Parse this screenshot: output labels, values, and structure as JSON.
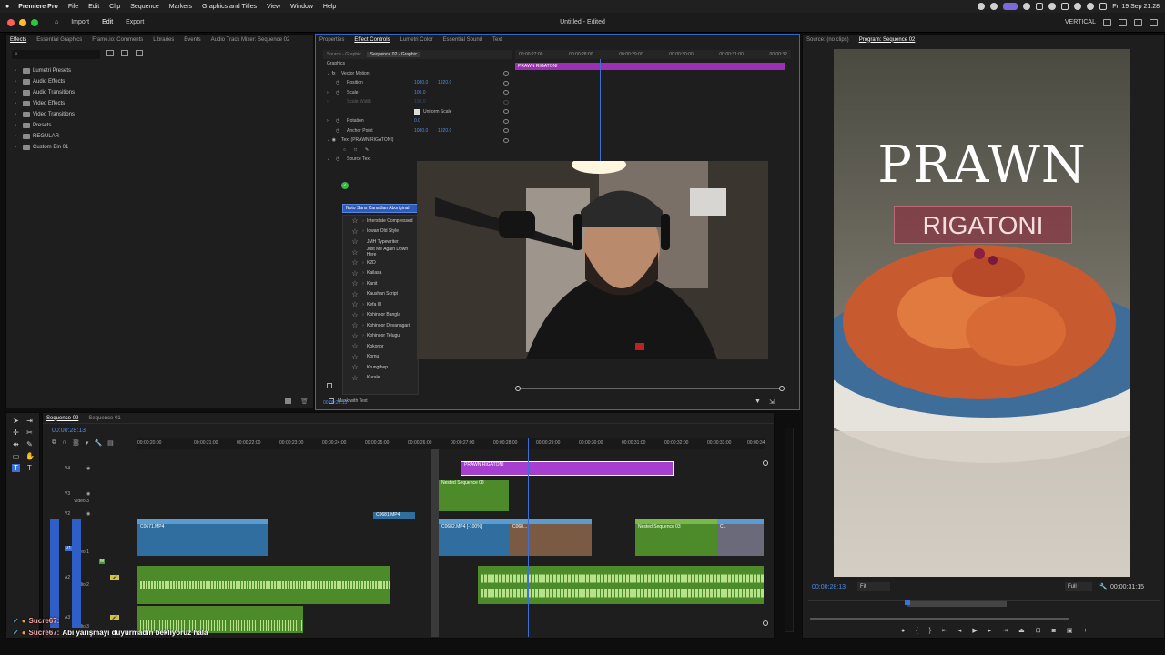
{
  "menubar": {
    "app": "Premiere Pro",
    "items": [
      "File",
      "Edit",
      "Clip",
      "Sequence",
      "Markers",
      "Graphics and Titles",
      "View",
      "Window",
      "Help"
    ],
    "datetime": "Fri 19 Sep  21:28"
  },
  "apptitle": {
    "nav": [
      "Import",
      "Edit",
      "Export"
    ],
    "active": "Edit",
    "title": "Untitled - Edited",
    "layout": "VERTICAL"
  },
  "effects_panel": {
    "tabs": [
      "Effects",
      "Essential Graphics",
      "Frame.io: Comments",
      "Libraries",
      "Events",
      "Audio Track Mixer: Sequence 02"
    ],
    "folders": [
      "Lumetri Presets",
      "Audio Effects",
      "Audio Transitions",
      "Video Effects",
      "Video Transitions",
      "Presets",
      "REGULAR",
      "Custom Bin 01"
    ]
  },
  "effect_controls": {
    "tabs": [
      "Properties",
      "Effect Controls",
      "Lumetri Color",
      "Essential Sound",
      "Text"
    ],
    "active_tab": "Effect Controls",
    "subtabs": [
      "Source - Graphic",
      "Sequence 02 - Graphic"
    ],
    "section": "Graphics",
    "vector_motion": "Vector Motion",
    "rows": [
      {
        "label": "Position",
        "v1": "1080.0",
        "v2": "1920.0"
      },
      {
        "label": "Scale",
        "v1": "100.0",
        "v2": ""
      },
      {
        "label": "Scale Width",
        "v1": "100.0",
        "v2": ""
      },
      {
        "label": "Uniform Scale",
        "v1": "",
        "v2": ""
      },
      {
        "label": "Rotation",
        "v1": "0.0",
        "v2": ""
      },
      {
        "label": "Anchor Point",
        "v1": "1080.0",
        "v2": "1920.0"
      }
    ],
    "text_layer": "Text (PRAWN RIGATONI)",
    "source_text": "Source Text",
    "font_selected": "Noto Sans Canadian Aboriginal",
    "fonts": [
      "Interstate Compressed",
      "Iowan Old Style",
      "JMH Typewriter",
      "Just Me Again Down Here",
      "K2D",
      "Kailasa",
      "Kanit",
      "Kaushan Script",
      "Kefa III",
      "Kohinoor Bangla",
      "Kohinoor Devanagari",
      "Kohinoor Telugu",
      "Kokonor",
      "Kornu",
      "Krungthep",
      "Kurale"
    ],
    "mask_label": "Mask with Text",
    "clip_name": "PRAWN RIGATONI",
    "ruler": [
      "00:00:27:00",
      "00:00:28:00",
      "00:00:29:00",
      "00:00:30:00",
      "00:00:31:00",
      "00:00:32"
    ],
    "timecode": "00:00:28:13"
  },
  "program": {
    "tabs": [
      "Source: (no clips)",
      "Program: Sequence 02"
    ],
    "title_line1": "PRAWN",
    "title_line2": "RIGATONI",
    "timecode": "00:00:28:13",
    "fit": "Fit",
    "quality": "Full",
    "duration": "00:00:31:15"
  },
  "timeline": {
    "tabs": [
      "Sequence 02",
      "Sequence 01"
    ],
    "timecode": "00:00:28:13",
    "ruler": [
      "00:00:20:00",
      "00:00:21:00",
      "00:00:22:00",
      "00:00:23:00",
      "00:00:24:00",
      "00:00:25:00",
      "00:00:26:00",
      "00:00:27:00",
      "00:00:28:00",
      "00:00:29:00",
      "00:00:30:00",
      "00:00:31:00",
      "00:00:32:00",
      "00:00:33:00",
      "00:00:34"
    ],
    "tracks": [
      "V4",
      "V3",
      "Video 3",
      "V2",
      "V1",
      "Video 1",
      "A1",
      "A2",
      "Audio 2",
      "A3",
      "Audio 3"
    ],
    "clips": {
      "graphic": "PRAWN RIGATONI",
      "nested8": "Nested Sequence 08",
      "c0681": "C0681.MP4",
      "c0671": "C0671.MP4",
      "c0682": "C0682.MP4 [-100%]",
      "c068x": "C068...",
      "nested3": "Nested Sequence 03",
      "cl": "CL"
    }
  },
  "chat": [
    {
      "user": "Sucre67:",
      "text": ""
    },
    {
      "user": "Sucre67:",
      "text": "Abi yarışmayı duyurmadın bekliyoruz hala"
    }
  ],
  "colors": {
    "accent": "#3d6fd8",
    "clip_purple": "#a63ecf",
    "clip_blue": "#2f6e9e",
    "clip_green": "#4c8a2a",
    "tc_blue": "#4e8ee8"
  }
}
